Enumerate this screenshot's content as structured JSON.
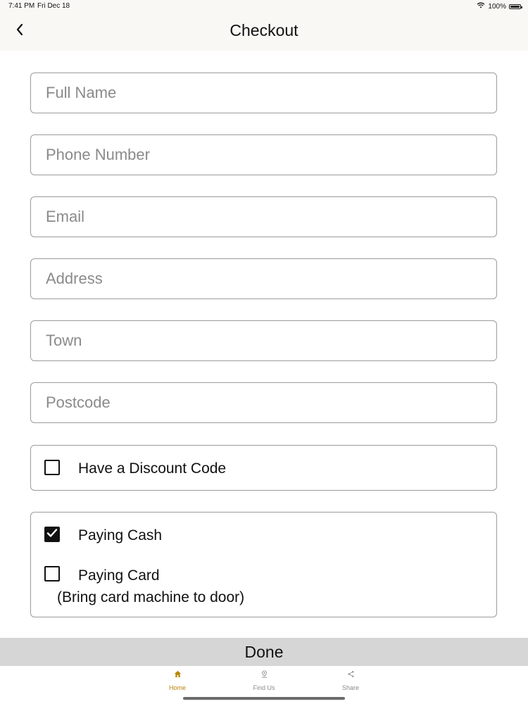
{
  "status_bar": {
    "time": "7:41 PM",
    "date": "Fri Dec 18",
    "battery": "100%"
  },
  "nav": {
    "title": "Checkout"
  },
  "form": {
    "full_name_placeholder": "Full Name",
    "phone_placeholder": "Phone Number",
    "email_placeholder": "Email",
    "address_placeholder": "Address",
    "town_placeholder": "Town",
    "postcode_placeholder": "Postcode",
    "discount_label": "Have a Discount Code",
    "discount_checked": false,
    "paying_cash_label": "Paying Cash",
    "paying_cash_checked": true,
    "paying_card_label": "Paying Card",
    "paying_card_checked": false,
    "paying_card_note": "(Bring card machine to door)"
  },
  "done_label": "Done",
  "tabs": [
    {
      "label": "Home",
      "icon": "home-icon",
      "active": true
    },
    {
      "label": "Find Us",
      "icon": "map-pin-icon",
      "active": false
    },
    {
      "label": "Share",
      "icon": "share-icon",
      "active": false
    }
  ],
  "colors": {
    "accent": "#b8860b",
    "done_bar": "#d6d6d6",
    "header_bg": "#faf8f4"
  }
}
